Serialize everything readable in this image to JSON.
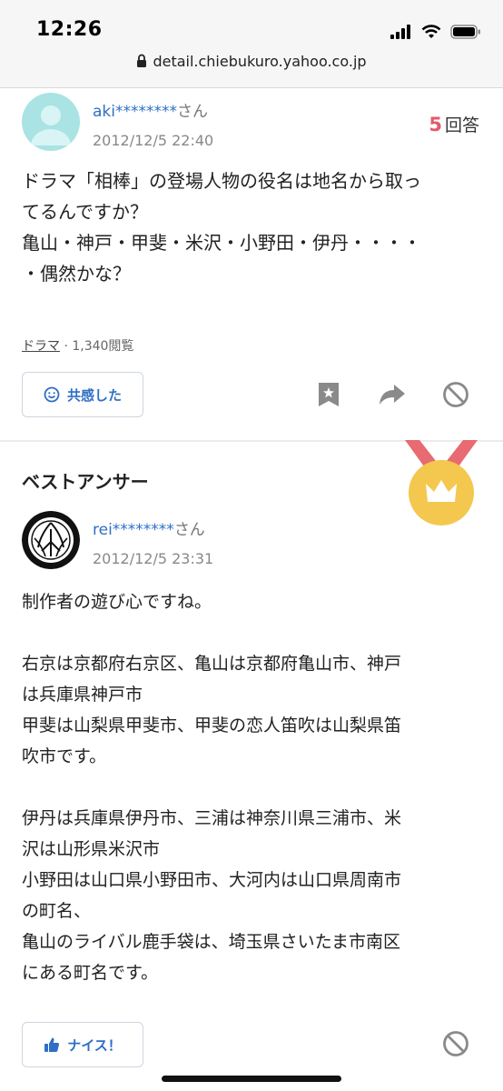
{
  "status_bar": {
    "time": "12:26"
  },
  "browser": {
    "url": "detail.chiebukuro.yahoo.co.jp"
  },
  "question": {
    "user_name": "aki********",
    "user_suffix": "さん",
    "date": "2012/12/5 22:40",
    "answer_count": "5",
    "answer_label": "回答",
    "lines": [
      "ドラマ「相棒」の登場人物の役名は地名から取っ",
      "てるんですか？",
      "亀山・神戸・甲斐・米沢・小野田・伊丹・・・・",
      "・偶然かな？"
    ],
    "category": "ドラマ",
    "views": "· 1,340閲覧",
    "empathy_label": "共感した"
  },
  "best_answer": {
    "title": "ベストアンサー",
    "user_name": "rei********",
    "user_suffix": "さん",
    "date": "2012/12/5 23:31",
    "lines": [
      "制作者の遊び心ですね。",
      "",
      "右京は京都府右京区、亀山は京都府亀山市、神戸",
      "は兵庫県神戸市",
      "甲斐は山梨県甲斐市、甲斐の恋人笛吹は山梨県笛",
      "吹市です。",
      "",
      "伊丹は兵庫県伊丹市、三浦は神奈川県三浦市、米",
      "沢は山形県米沢市",
      "小野田は山口県小野田市、大河内は山口県周南市",
      "の町名、",
      "亀山のライバル鹿手袋は、埼玉県さいたま市南区",
      "にある町名です。"
    ],
    "nice_label": "ナイス！"
  },
  "colors": {
    "link": "#2f6fc6",
    "answer_count": "#e35b6a",
    "medal": "#f4c74f",
    "ribbon": "#e86a72"
  },
  "icons": [
    "lock-icon",
    "signal-icon",
    "wifi-icon",
    "battery-icon",
    "smile-icon",
    "bookmark-icon",
    "share-icon",
    "block-icon",
    "thumbs-up-icon",
    "medal-icon",
    "crown-icon"
  ]
}
